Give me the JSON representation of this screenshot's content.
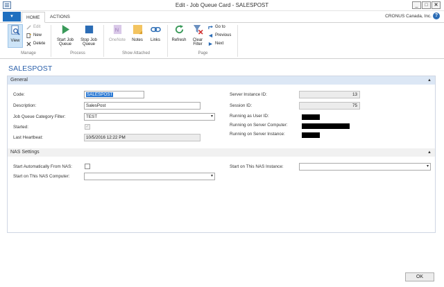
{
  "window": {
    "title": "Edit - Job Queue Card - SALESPOST"
  },
  "tabs": {
    "home": "HOME",
    "actions": "ACTIONS"
  },
  "company": "CRONUS Canada, Inc.",
  "help": "?",
  "ribbon": {
    "manage": {
      "label": "Manage",
      "view": "View",
      "edit": "Edit",
      "new": "New",
      "delete": "Delete"
    },
    "process": {
      "label": "Process",
      "start_line1": "Start Job",
      "start_line2": "Queue",
      "stop_line1": "Stop Job",
      "stop_line2": "Queue"
    },
    "show_attached": {
      "label": "Show Attached",
      "onenote": "OneNote",
      "notes": "Notes",
      "links": "Links"
    },
    "page": {
      "label": "Page",
      "refresh": "Refresh",
      "clear_line1": "Clear",
      "clear_line2": "Filter",
      "goto": "Go to",
      "previous": "Previous",
      "next": "Next"
    }
  },
  "page_title": "SALESPOST",
  "general": {
    "header": "General",
    "code_label": "Code:",
    "code_value": "SALESPOST",
    "description_label": "Description:",
    "description_value": "SalesPost",
    "category_label": "Job Queue Category Filter:",
    "category_value": "TEST",
    "started_label": "Started:",
    "started_checked": true,
    "heartbeat_label": "Last Heartbeat:",
    "heartbeat_value": "10/5/2016 12:22 PM",
    "server_instance_label": "Server Instance ID:",
    "server_instance_value": "13",
    "session_label": "Session ID:",
    "session_value": "75",
    "running_user_label": "Running as User ID:",
    "running_computer_label": "Running on Server Computer:",
    "running_instance_label": "Running on Server Instance:"
  },
  "nas": {
    "header": "NAS Settings",
    "auto_start_label": "Start Automatically From NAS:",
    "computer_label": "Start on This NAS Computer:",
    "instance_label": "Start on This NAS Instance:"
  },
  "footer": {
    "ok": "OK"
  },
  "colors": {
    "accent": "#1f6fbf",
    "title_blue": "#2a5faa",
    "header_bg": "#dce7f5"
  }
}
